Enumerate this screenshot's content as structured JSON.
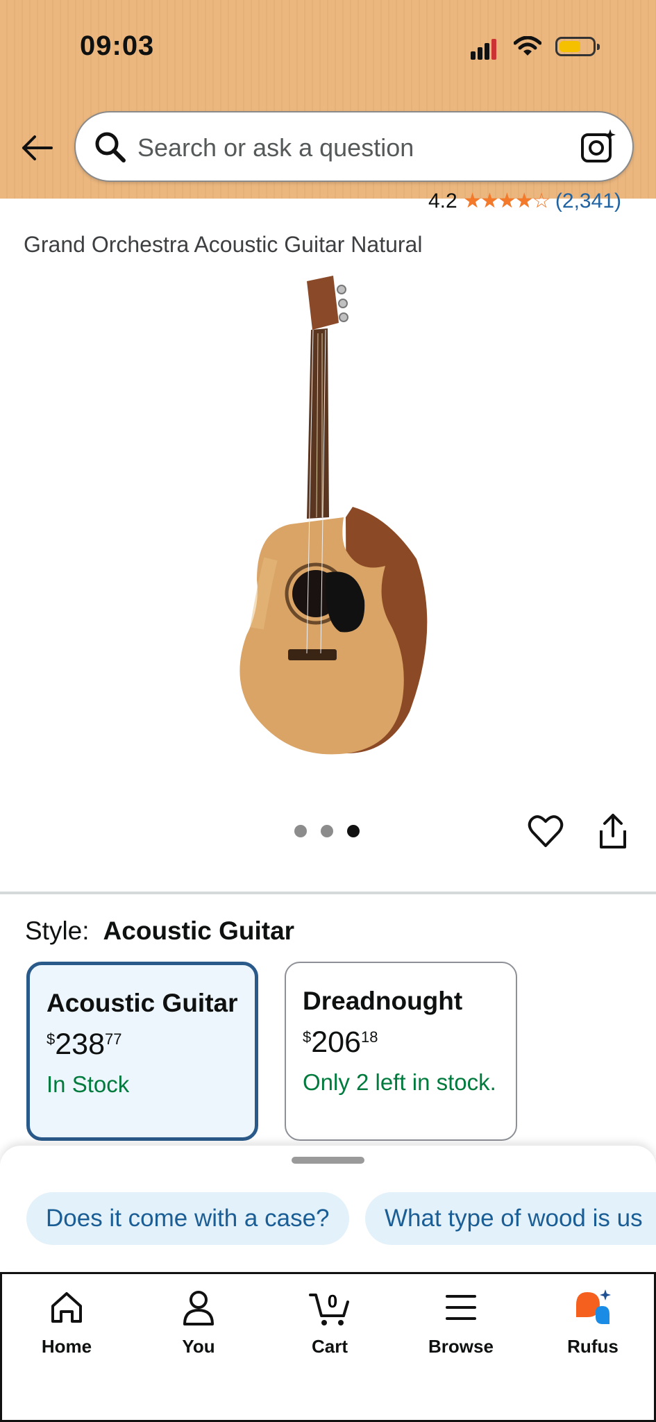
{
  "status_bar": {
    "time": "09:03"
  },
  "search": {
    "placeholder": "Search or ask a question"
  },
  "product": {
    "rating": "4.2",
    "stars": "★★★★☆",
    "rating_count": "(2,341)",
    "title": "Grand Orchestra Acoustic Guitar Natural",
    "image_count": 3,
    "active_image": 3
  },
  "style": {
    "label": "Style:",
    "selected": "Acoustic Guitar",
    "options": [
      {
        "name": "Acoustic Guitar",
        "currency": "$",
        "price_whole": "238",
        "price_fraction": "77",
        "stock": "In Stock"
      },
      {
        "name": "Dreadnought",
        "currency": "$",
        "price_whole": "206",
        "price_fraction": "18",
        "stock": "Only 2 left in stock."
      }
    ]
  },
  "suggestions": [
    "Does it come with a case?",
    "What type of wood is us"
  ],
  "nav": {
    "home": "Home",
    "you": "You",
    "cart": "Cart",
    "cart_count": "0",
    "browse": "Browse",
    "rufus": "Rufus"
  },
  "colors": {
    "header_bg": "#ebb77f",
    "star": "#f3792b",
    "link": "#2162a1",
    "stock_green": "#007a3d",
    "selected_border": "#2a5a8a",
    "chip_bg": "#e3f1fa",
    "rufus_orange": "#f6601e",
    "rufus_blue": "#1a8ce6"
  }
}
